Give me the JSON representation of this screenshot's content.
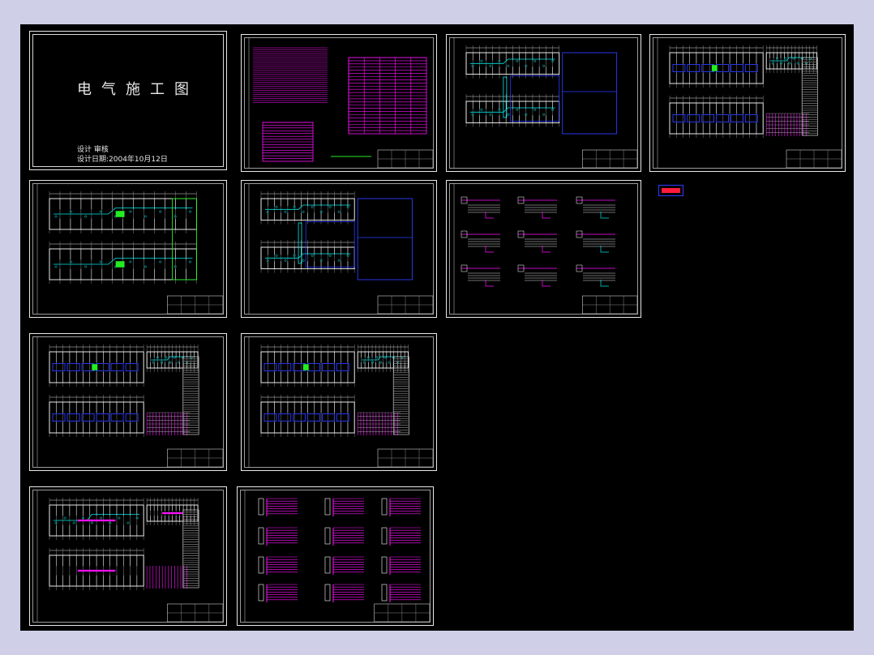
{
  "cover": {
    "title": "电气施工图",
    "designer_line": "设计 审核",
    "date_line": "设计日期:2004年10月12日"
  },
  "colors": {
    "background": "#000000",
    "frame": "#cfd0e8",
    "line": "#e8e8e8",
    "blue": "#2c3cff",
    "cyan": "#00e5e5",
    "magenta": "#ff10ff",
    "green": "#22ee22",
    "yellow": "#e8e800"
  },
  "sheets": [
    {
      "name": "cover-sheet",
      "kind": "cover"
    },
    {
      "name": "design-notes-sheet",
      "kind": "notes"
    },
    {
      "name": "ground-floor-power-plan-sheet",
      "kind": "plan-simple"
    },
    {
      "name": "first-floor-lighting-plan-sheet",
      "kind": "plan-rooms"
    },
    {
      "name": "second-floor-lighting-plan-sheet",
      "kind": "plan-lighting"
    },
    {
      "name": "second-floor-power-plan-sheet",
      "kind": "plan-simple"
    },
    {
      "name": "system-diagram-sheet",
      "kind": "system"
    },
    {
      "name": "third-floor-lighting-plan-sheet",
      "kind": "plan-rooms"
    },
    {
      "name": "fourth-floor-lighting-plan-sheet",
      "kind": "plan-rooms"
    },
    {
      "name": "roof-plan-sheet",
      "kind": "plan-roof"
    },
    {
      "name": "distribution-box-diagram-sheet",
      "kind": "boxes"
    }
  ]
}
